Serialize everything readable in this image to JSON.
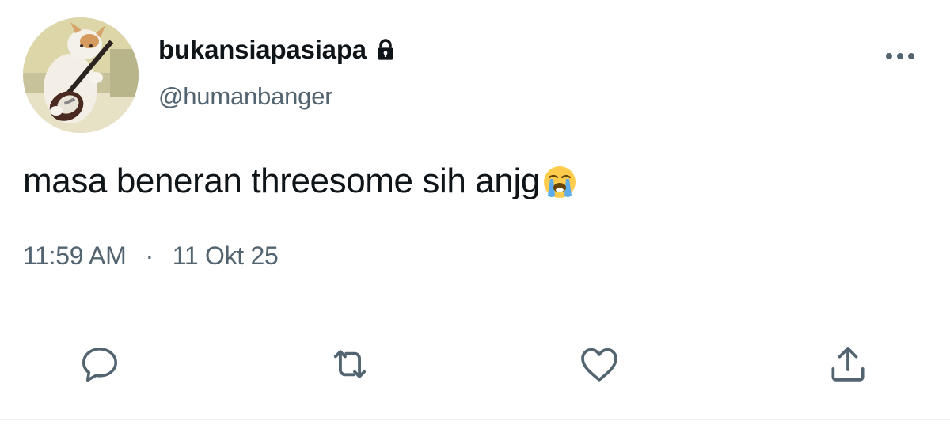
{
  "tweet": {
    "author": {
      "display_name": "bukansiapasiapa",
      "handle": "@humanbanger",
      "protected_icon": "lock-icon",
      "avatar": "cat-playing-guitar-avatar"
    },
    "text": "masa beneran threesome sih anjg",
    "emoji": "loudly-crying-face-emoji",
    "time": "11:59 AM",
    "separator": "·",
    "date": "11 Okt 25"
  },
  "actions": [
    {
      "name": "reply",
      "icon": "speech-bubble-icon"
    },
    {
      "name": "retweet",
      "icon": "retweet-arrows-icon"
    },
    {
      "name": "like",
      "icon": "heart-icon"
    },
    {
      "name": "share",
      "icon": "share-upload-icon"
    }
  ],
  "more_menu_icon": "more-horizontal-icon",
  "colors": {
    "text_primary": "#0f1419",
    "text_secondary": "#536471",
    "divider": "#e1e4e8"
  }
}
